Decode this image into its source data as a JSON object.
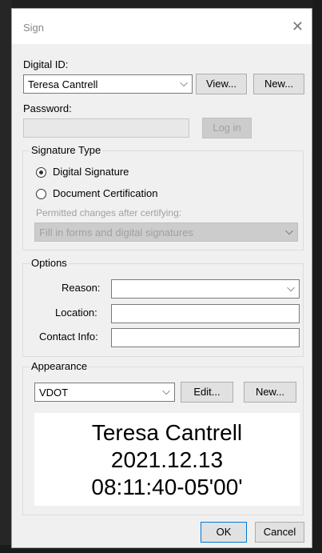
{
  "dialog": {
    "title": "Sign"
  },
  "digital_id": {
    "label": "Digital ID:",
    "selected": "Teresa Cantrell",
    "view_label": "View...",
    "new_label": "New..."
  },
  "password": {
    "label": "Password:",
    "value": "",
    "login_label": "Log in"
  },
  "signature_type": {
    "title": "Signature Type",
    "options": [
      {
        "label": "Digital Signature",
        "selected": true
      },
      {
        "label": "Document Certification",
        "selected": false
      }
    ],
    "permitted_label": "Permitted changes after certifying:",
    "permitted_value": "Fill in forms and digital signatures"
  },
  "options": {
    "title": "Options",
    "reason_label": "Reason:",
    "reason_value": "",
    "location_label": "Location:",
    "location_value": "",
    "contact_label": "Contact Info:",
    "contact_value": ""
  },
  "appearance": {
    "title": "Appearance",
    "selected": "VDOT",
    "edit_label": "Edit...",
    "new_label": "New...",
    "preview_lines": [
      "Teresa Cantrell",
      "2021.12.13",
      "08:11:40-05'00'"
    ]
  },
  "footer": {
    "ok_label": "OK",
    "cancel_label": "Cancel"
  },
  "icons": {
    "close": "close-icon",
    "chevron": "chevron-down-icon"
  }
}
